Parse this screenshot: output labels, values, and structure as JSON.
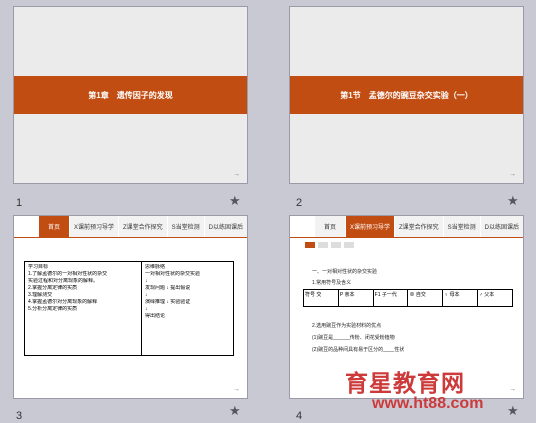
{
  "slides": [
    {
      "num": "1",
      "title": "第1章　遗传因子的发现",
      "arrow": "→"
    },
    {
      "num": "2",
      "title": "第1节　孟德尔的豌豆杂交实验（一）",
      "arrow": "→"
    },
    {
      "num": "3",
      "arrow": "→",
      "tabs": [
        "首页",
        "X课前预习导学",
        "Z课堂合作探究",
        "S当堂检测",
        "D以练固课后"
      ],
      "left_lines": [
        "学习目标",
        "1.了解孟德尔的一对相对性状的杂交",
        "实验过程和对分离现象的解释。",
        "2.掌握分离定律的实质",
        "3.理解测交",
        "4.掌握孟德尔对分离现象的解释",
        "5.分析分离定律的实质"
      ],
      "right_lines": [
        "思维脉络",
        "一对相对性状的杂交实验",
        "↓",
        "发现问题 ↓ 提出假说",
        "↓",
        "演绎推理 ↓ 实验验证",
        "↓",
        "得出结论"
      ]
    },
    {
      "num": "4",
      "arrow": "→",
      "tabs": [
        "首页",
        "X课前预习导学",
        "Z课堂合作探究",
        "S当堂检测",
        "D以练固课后"
      ],
      "heading": "一、一对相对性状的杂交实验",
      "sub": "1.常用符号及含义",
      "cells": [
        "符号 交",
        "P 亲本",
        "F1 子一代",
        "⊗ 自交",
        "♀ 母本",
        "♂ 父本"
      ],
      "line1": "2.选用豌豆作为实验材料的优点",
      "line2": "(1)豌豆是______传粉、闭花受粉植物",
      "line3": "(2)豌豆的品种间具有易于区分的____性状"
    }
  ],
  "watermark": "育星教育网",
  "watermark_url": "www.ht88.com"
}
